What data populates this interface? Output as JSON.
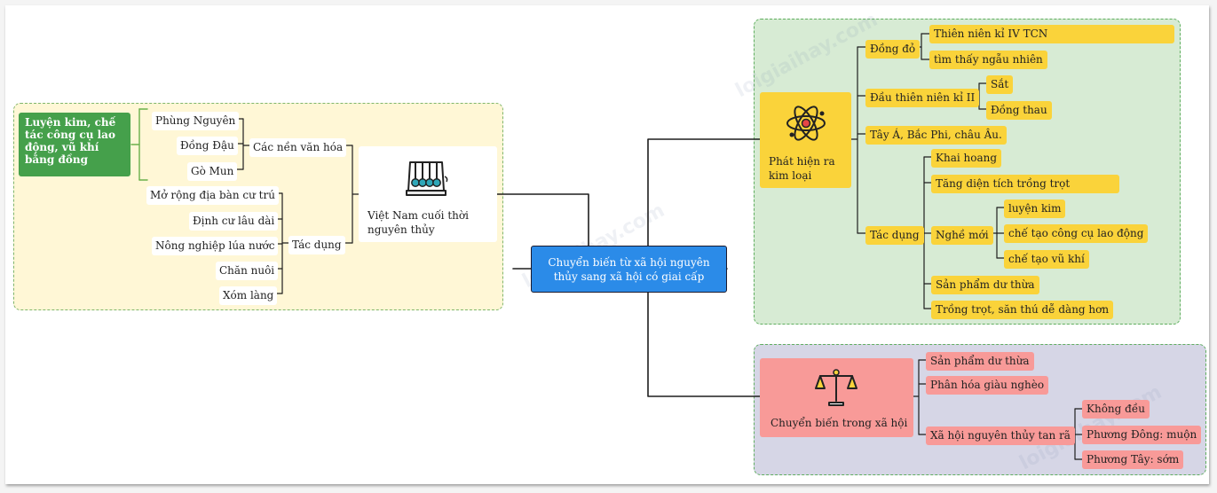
{
  "center": {
    "title": "Chuyển biến từ xã hội nguyên thủy sang xã hội có giai cấp"
  },
  "left": {
    "topic": "Việt Nam cuối thời nguyên thủy",
    "metallurgy": "Luyện kim, chế tác công cụ lao động, vũ khí bằng đồng",
    "cultures_label": "Các nền văn hóa",
    "cultures": [
      "Phùng Nguyên",
      "Đồng Đậu",
      "Gò Mun"
    ],
    "effects_label": "Tác dụng",
    "effects": [
      "Mở rộng địa bàn cư trú",
      "Định cư lâu dài",
      "Nông nghiệp lúa nước",
      "Chăn nuôi",
      "Xóm làng"
    ]
  },
  "metal": {
    "topic": "Phát hiện ra kim loại",
    "copper": {
      "label": "Đồng đỏ",
      "items": [
        "Thiên niên kỉ IV TCN",
        "tìm thấy ngẫu nhiên"
      ]
    },
    "millennium": {
      "label": "Đầu thiên niên kỉ II",
      "items": [
        "Sắt",
        "Đồng thau"
      ]
    },
    "regions": "Tây Á, Bắc Phi, châu Âu.",
    "effects": {
      "label": "Tác dụng",
      "items": [
        "Khai hoang",
        "Tăng  diện tích trồng trọt"
      ],
      "new_trades": {
        "label": "Nghề mới",
        "items": [
          "luyện kim",
          "chế tạo công cụ lao động",
          "chế tạo vũ khí"
        ]
      },
      "tail": [
        "Sản phẩm dư thừa",
        "Trồng trọt, săn thú dễ dàng hơn"
      ]
    }
  },
  "society": {
    "topic": "Chuyển biến trong xã hội",
    "items": [
      "Sản phẩm dư thừa",
      "Phân hóa giàu nghèo"
    ],
    "collapse": {
      "label": "Xã hội nguyên thủy tan rã",
      "items": [
        "Không đều",
        "Phương Đông: muộn",
        "Phương Tây: sớm"
      ]
    }
  },
  "colors": {
    "center": "#2b8be8",
    "yellow": "#fad33a",
    "pink": "#f89a98",
    "green": "#45a04b"
  },
  "icons": {
    "left": "newtons-cradle-icon",
    "metal": "atom-icon",
    "society": "balance-scale-icon"
  }
}
